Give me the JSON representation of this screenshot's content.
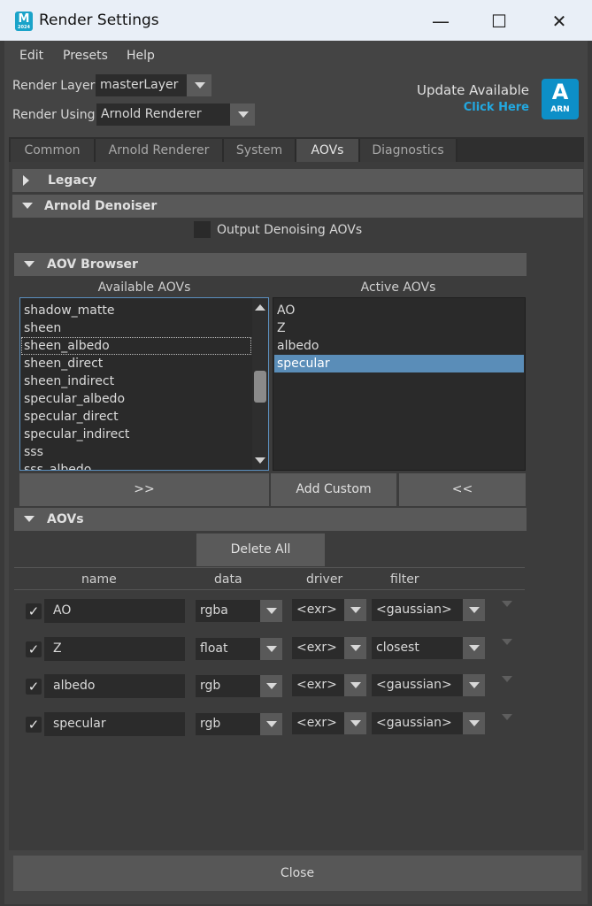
{
  "window": {
    "title": "Render Settings",
    "app_icon_letter": "M",
    "app_icon_sub": "2024"
  },
  "menu": [
    "Edit",
    "Presets",
    "Help"
  ],
  "render_layer": {
    "label": "Render Layer",
    "value": "masterLayer"
  },
  "render_using": {
    "label": "Render Using",
    "value": "Arnold Renderer"
  },
  "update": {
    "title": "Update Available",
    "link": "Click Here",
    "badge_letter": "A",
    "badge_sub": "ARN"
  },
  "tabs": [
    {
      "label": "Common",
      "active": false
    },
    {
      "label": "Arnold Renderer",
      "active": false
    },
    {
      "label": "System",
      "active": false
    },
    {
      "label": "AOVs",
      "active": true
    },
    {
      "label": "Diagnostics",
      "active": false
    }
  ],
  "sections": {
    "legacy": "Legacy",
    "denoiser": "Arnold Denoiser",
    "aov_browser": "AOV Browser",
    "aovs": "AOVs"
  },
  "denoiser": {
    "output_label": "Output Denoising AOVs",
    "checked": false
  },
  "browser": {
    "available_label": "Available AOVs",
    "active_label": "Active AOVs",
    "available": [
      "shadow_matte",
      "sheen",
      "sheen_albedo",
      "sheen_direct",
      "sheen_indirect",
      "specular_albedo",
      "specular_direct",
      "specular_indirect",
      "sss",
      "sss_albedo"
    ],
    "available_focused": "sheen_albedo",
    "active": [
      "AO",
      "Z",
      "albedo",
      "specular"
    ],
    "active_selected": "specular",
    "add_all_label": ">>",
    "add_custom_label": "Add Custom",
    "remove_label": "<<"
  },
  "aovs": {
    "delete_all_label": "Delete All",
    "columns": [
      "name",
      "data",
      "driver",
      "filter"
    ],
    "rows": [
      {
        "enabled": true,
        "name": "AO",
        "data": "rgba",
        "driver": "<exr>",
        "filter": "<gaussian>"
      },
      {
        "enabled": true,
        "name": "Z",
        "data": "float",
        "driver": "<exr>",
        "filter": "closest"
      },
      {
        "enabled": true,
        "name": "albedo",
        "data": "rgb",
        "driver": "<exr>",
        "filter": "<gaussian>"
      },
      {
        "enabled": true,
        "name": "specular",
        "data": "rgb",
        "driver": "<exr>",
        "filter": "<gaussian>"
      }
    ]
  },
  "close_label": "Close",
  "window_controls": {
    "minimize": "—",
    "maximize": "☐",
    "close": "✕"
  },
  "check_glyph": "✓"
}
